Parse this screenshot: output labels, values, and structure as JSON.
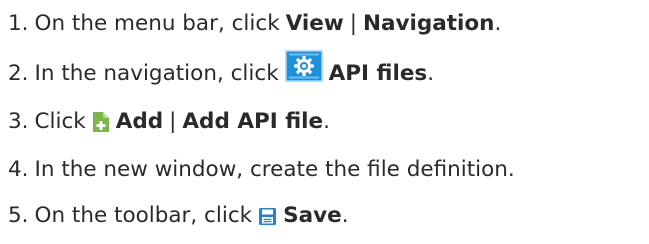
{
  "steps": [
    {
      "number": "1.",
      "text": "On the menu bar, click",
      "bold_1": "View",
      "separator": "|",
      "bold_2": "Navigation",
      "end": "."
    },
    {
      "number": "2.",
      "text": "In the navigation, click",
      "icon": "api-files-gear-icon",
      "bold_1": "API files",
      "end": "."
    },
    {
      "number": "3.",
      "text": "Click",
      "icon": "add-document-icon",
      "bold_1": "Add",
      "separator": "|",
      "bold_2": "Add API file",
      "end": "."
    },
    {
      "number": "4.",
      "text": "In the new window, create the file definition."
    },
    {
      "number": "5.",
      "text": "On the toolbar, click",
      "icon": "save-icon",
      "bold_1": "Save",
      "end": "."
    }
  ],
  "colors": {
    "text": "#2a2a2a",
    "api_icon_blue": "#1e8fd8",
    "add_icon_green": "#7ab648",
    "save_icon_blue": "#2a7fd0"
  }
}
